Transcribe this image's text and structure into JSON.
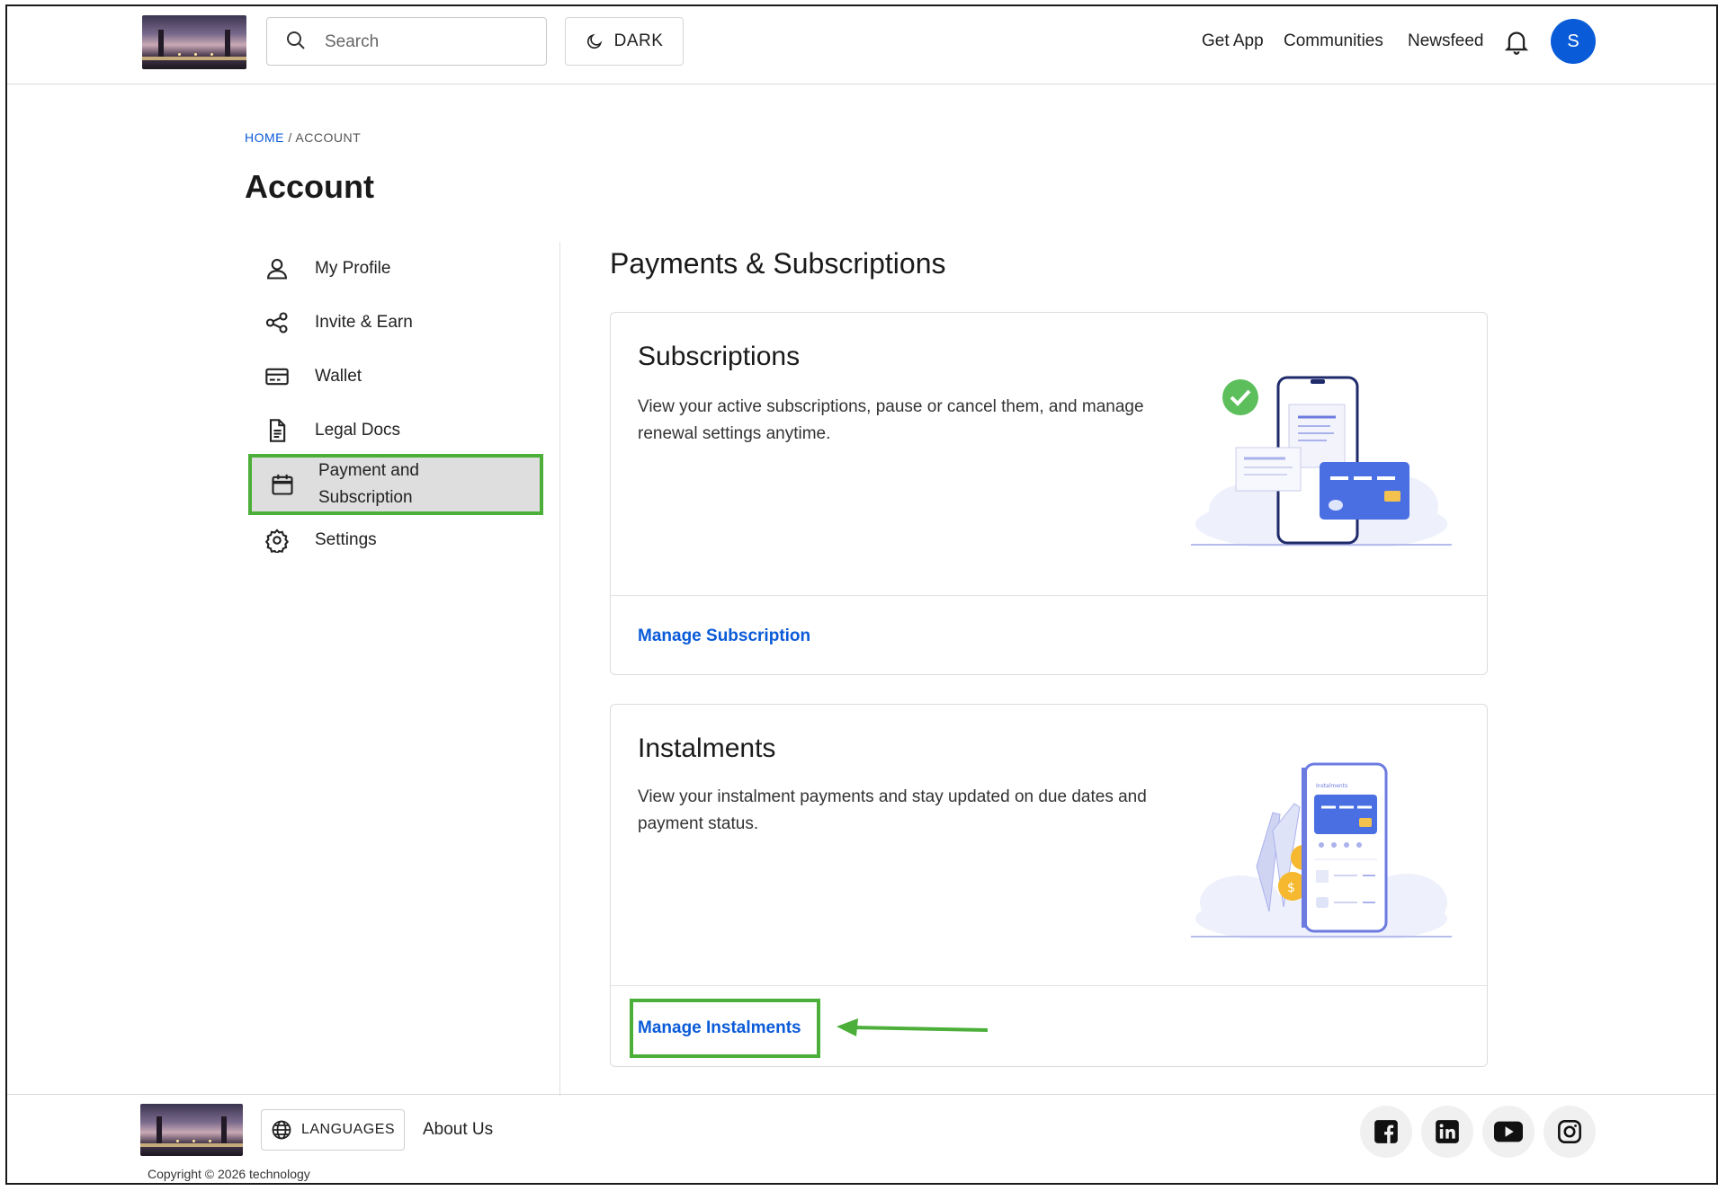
{
  "header": {
    "search_placeholder": "Search",
    "dark_label": "DARK",
    "nav": [
      "Get App",
      "Communities",
      "Newsfeed"
    ],
    "avatar_initial": "S"
  },
  "breadcrumb": {
    "home": "HOME",
    "separator": " / ",
    "current": "ACCOUNT"
  },
  "page_title": "Account",
  "sidebar": {
    "items": [
      {
        "label": "My Profile",
        "icon": "user-icon"
      },
      {
        "label": "Invite & Earn",
        "icon": "share-icon"
      },
      {
        "label": "Wallet",
        "icon": "wallet-icon"
      },
      {
        "label": "Legal Docs",
        "icon": "document-icon"
      },
      {
        "label": "Payment and Subscription",
        "icon": "calendar-icon",
        "active": true
      },
      {
        "label": "Settings",
        "icon": "gear-icon"
      }
    ]
  },
  "main": {
    "section_title": "Payments & Subscriptions",
    "cards": [
      {
        "title": "Subscriptions",
        "description": "View your active subscriptions, pause or cancel them, and manage renewal settings anytime.",
        "link": "Manage Subscription"
      },
      {
        "title": "Instalments",
        "description": "View your instalment payments and stay updated on due dates and payment status.",
        "link": "Manage Instalments",
        "illustration_text": "Instalments"
      }
    ]
  },
  "footer": {
    "languages_label": "LANGUAGES",
    "about_label": "About Us",
    "copyright": "Copyright © 2026 technology",
    "social": [
      "facebook-icon",
      "linkedin-icon",
      "youtube-icon",
      "instagram-icon"
    ]
  },
  "colors": {
    "accent": "#0a5bd8",
    "highlight": "#4caf3a",
    "active_bg": "#dedede"
  }
}
